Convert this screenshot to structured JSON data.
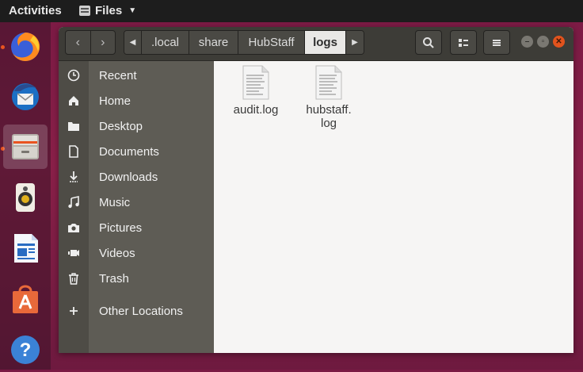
{
  "topbar": {
    "activities": "Activities",
    "app_name": "Files"
  },
  "dock": {
    "items": [
      "firefox-icon",
      "thunderbird-icon",
      "files-icon",
      "rhythmbox-icon",
      "writer-icon",
      "software-icon",
      "help-icon"
    ]
  },
  "window": {
    "path": {
      "crumbs": [
        ".local",
        "share",
        "HubStaff",
        "logs"
      ]
    },
    "sidebar": {
      "items": [
        {
          "label": "Recent",
          "icon": "clock-icon"
        },
        {
          "label": "Home",
          "icon": "home-icon"
        },
        {
          "label": "Desktop",
          "icon": "folder-icon"
        },
        {
          "label": "Documents",
          "icon": "document-icon"
        },
        {
          "label": "Downloads",
          "icon": "download-icon"
        },
        {
          "label": "Music",
          "icon": "music-icon"
        },
        {
          "label": "Pictures",
          "icon": "camera-icon"
        },
        {
          "label": "Videos",
          "icon": "video-icon"
        },
        {
          "label": "Trash",
          "icon": "trash-icon"
        },
        {
          "label": "Other Locations",
          "icon": "plus-icon"
        }
      ]
    },
    "files": [
      {
        "name": "audit.log"
      },
      {
        "name": "hubstaff.\nlog"
      }
    ]
  },
  "colors": {
    "accent": "#e95420",
    "headerbar": "#3d3c37",
    "sidebar": "#5e5c55"
  }
}
